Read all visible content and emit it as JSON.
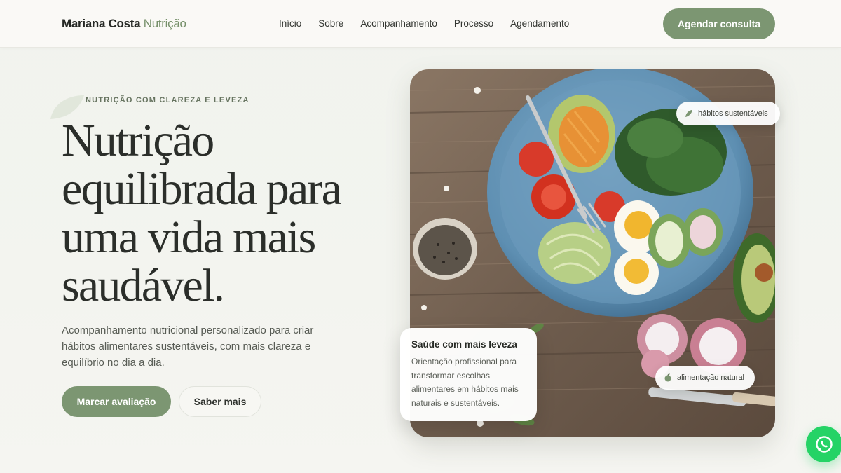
{
  "brand": {
    "name": "Mariana Costa",
    "accent": "Nutrição"
  },
  "nav": {
    "items": [
      "Início",
      "Sobre",
      "Acompanhamento",
      "Processo",
      "Agendamento"
    ]
  },
  "header": {
    "cta_label": "Agendar consulta"
  },
  "hero": {
    "eyebrow": "NUTRIÇÃO COM CLAREZA E LEVEZA",
    "title": "Nutrição equilibrada para uma vida mais saudável.",
    "subtitle": "Acompanhamento nutricional personalizado para criar hábitos alimentares sustentáveis, com mais clareza e equilíbrio no dia a dia.",
    "primary_button": "Marcar avaliação",
    "secondary_button": "Saber mais"
  },
  "image_badges": {
    "top": "hábitos sustentáveis",
    "bottom": "alimentação natural"
  },
  "info_card": {
    "title": "Saúde com mais leveza",
    "text": "Orientação profissional para transformar escolhas alimentares em hábitos mais naturais e sustentáveis."
  },
  "colors": {
    "accent": "#7c9672",
    "background": "#f2f3ee",
    "whatsapp": "#25d366"
  },
  "icons": [
    "leaf-icon",
    "apple-icon",
    "whatsapp-icon"
  ]
}
